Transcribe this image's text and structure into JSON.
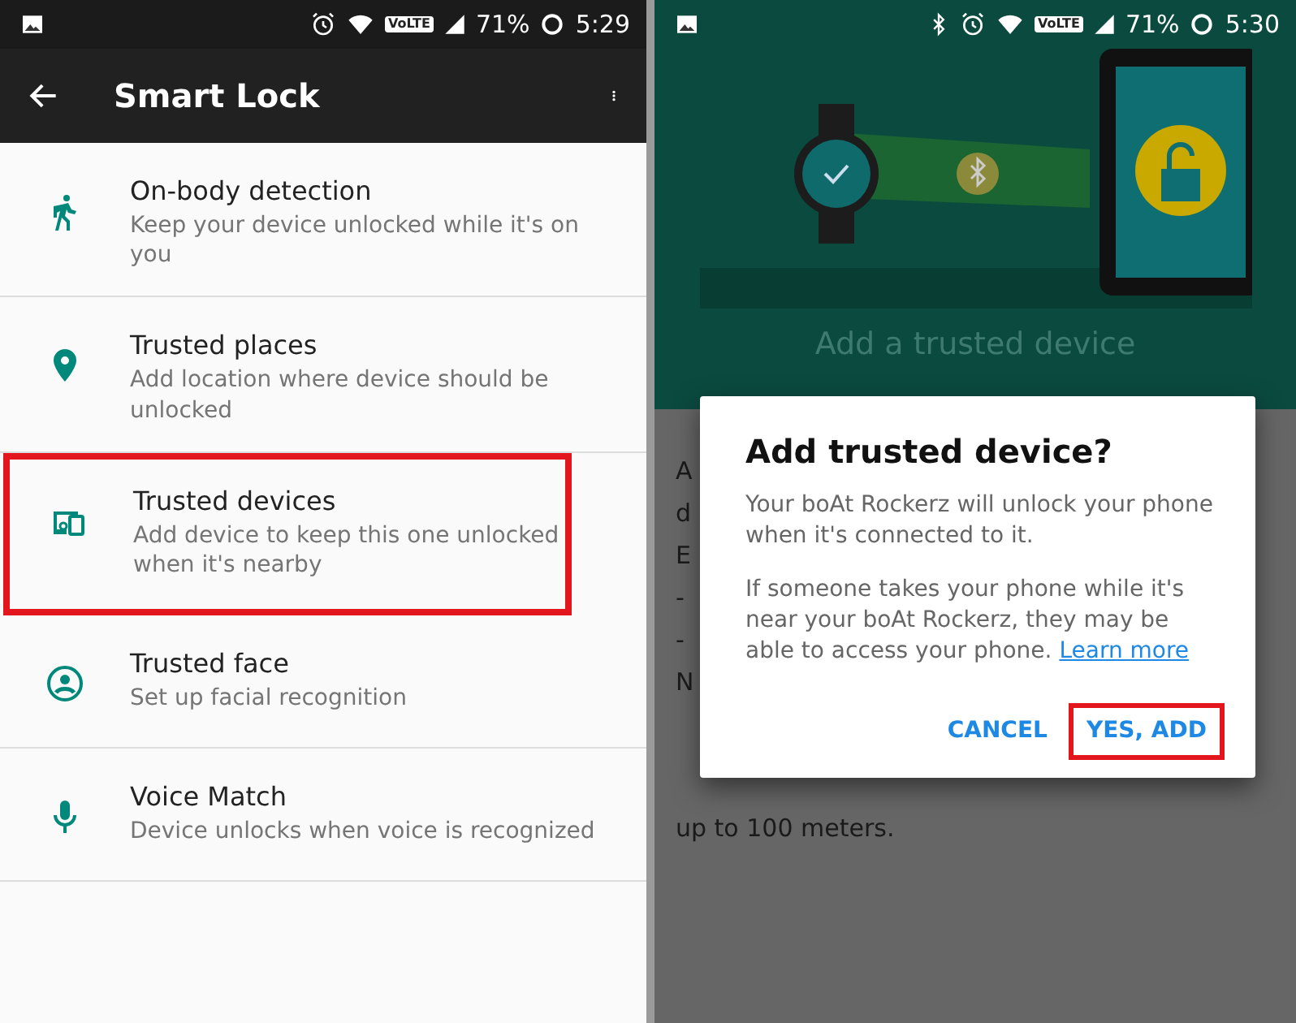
{
  "screens": [
    {
      "status_bar": {
        "bluetooth": false,
        "network": "VoLTE",
        "battery": "71%",
        "time": "5:29"
      },
      "toolbar": {
        "title": "Smart Lock"
      },
      "items": [
        {
          "title": "On-body detection",
          "subtitle": "Keep your device unlocked while it's on you",
          "highlighted": false
        },
        {
          "title": "Trusted places",
          "subtitle": "Add location where device should be unlocked",
          "highlighted": false
        },
        {
          "title": "Trusted devices",
          "subtitle": "Add device to keep this one unlocked when it's nearby",
          "highlighted": true
        },
        {
          "title": "Trusted face",
          "subtitle": "Set up facial recognition",
          "highlighted": false
        },
        {
          "title": "Voice Match",
          "subtitle": "Device unlocks when voice is recognized",
          "highlighted": false
        }
      ]
    },
    {
      "status_bar": {
        "bluetooth": true,
        "network": "VoLTE",
        "battery": "71%",
        "time": "5:30"
      },
      "header": {
        "title": "Add a trusted device"
      },
      "background_text": [
        "A",
        "d",
        "E",
        "-",
        "-",
        "N"
      ],
      "below_dialog_text": "up to 100 meters.",
      "dialog": {
        "title": "Add trusted device?",
        "paragraphs": [
          "Your boAt Rockerz will unlock your phone when it's connected to it.",
          "If someone takes your phone while it's near your boAt Rockerz, they may be able to access your phone."
        ],
        "link": "Learn more",
        "buttons": [
          {
            "label": "CANCEL",
            "highlighted": false
          },
          {
            "label": "YES, ADD",
            "highlighted": true
          }
        ]
      }
    }
  ]
}
